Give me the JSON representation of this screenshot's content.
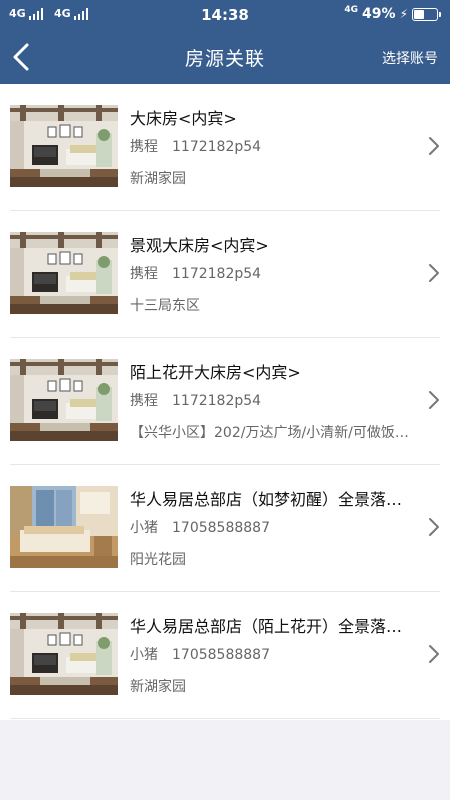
{
  "status_bar": {
    "signal_1": "4G",
    "signal_2": "4G",
    "time": "14:38",
    "network": "4G",
    "battery_text": "49%",
    "battery_level": 0.49
  },
  "nav": {
    "title": "房源关联",
    "action": "选择账号",
    "back_icon": "chevron-left-icon"
  },
  "listings": [
    {
      "title": "大床房<内宾>",
      "source": "携程",
      "code": "1172182p54",
      "address": "新湖家园",
      "thumb": "living-room"
    },
    {
      "title": "景观大床房<内宾>",
      "source": "携程",
      "code": "1172182p54",
      "address": "十三局东区",
      "thumb": "living-room"
    },
    {
      "title": "陌上花开大床房<内宾>",
      "source": "携程",
      "code": "1172182p54",
      "address": "【兴华小区】202/万达广场/小清新/可做饭…",
      "thumb": "living-room"
    },
    {
      "title": "华人易居总部店（如梦初醒）全景落…",
      "source": "小猪",
      "code": "17058588887",
      "address": "阳光花园",
      "thumb": "bedroom"
    },
    {
      "title": "华人易居总部店（陌上花开）全景落…",
      "source": "小猪",
      "code": "17058588887",
      "address": "新湖家园",
      "thumb": "living-room"
    }
  ],
  "colors": {
    "header": "#375d8e",
    "page_background": "#f2f2f6"
  }
}
